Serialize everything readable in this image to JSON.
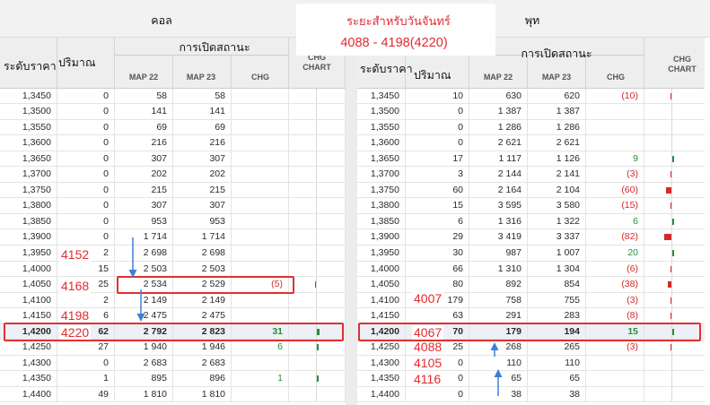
{
  "header": {
    "call_label": "คอล",
    "put_label": "พุท",
    "period_title": "ระยะสำหรับวันจันทร์",
    "range_text": "4088 - 4198(4220)"
  },
  "columns": {
    "strike": "ระดับราคา",
    "volume": "ปริมาณ",
    "open_interest": "การเปิดสถานะ",
    "map22": "MAP 22",
    "map23": "MAP 23",
    "chg": "CHG",
    "chg_chart": "CHG CHART"
  },
  "call_table": {
    "rows": [
      {
        "strike": "1,3450",
        "volume": "0",
        "map22": "58",
        "map23": "58",
        "chg": ""
      },
      {
        "strike": "1,3500",
        "volume": "0",
        "map22": "141",
        "map23": "141",
        "chg": ""
      },
      {
        "strike": "1,3550",
        "volume": "0",
        "map22": "69",
        "map23": "69",
        "chg": ""
      },
      {
        "strike": "1,3600",
        "volume": "0",
        "map22": "216",
        "map23": "216",
        "chg": ""
      },
      {
        "strike": "1,3650",
        "volume": "0",
        "map22": "307",
        "map23": "307",
        "chg": ""
      },
      {
        "strike": "1,3700",
        "volume": "0",
        "map22": "202",
        "map23": "202",
        "chg": ""
      },
      {
        "strike": "1,3750",
        "volume": "0",
        "map22": "215",
        "map23": "215",
        "chg": ""
      },
      {
        "strike": "1,3800",
        "volume": "0",
        "map22": "307",
        "map23": "307",
        "chg": ""
      },
      {
        "strike": "1,3850",
        "volume": "0",
        "map22": "953",
        "map23": "953",
        "chg": ""
      },
      {
        "strike": "1,3900",
        "volume": "0",
        "map22": "1 714",
        "map23": "1 714",
        "chg": ""
      },
      {
        "strike": "1,3950",
        "volume": "2",
        "map22": "2 698",
        "map23": "2 698",
        "chg": ""
      },
      {
        "strike": "1,4000",
        "volume": "15",
        "map22": "2 503",
        "map23": "2 503",
        "chg": ""
      },
      {
        "strike": "1,4050",
        "volume": "25",
        "map22": "2 534",
        "map23": "2 529",
        "chg": "(5)"
      },
      {
        "strike": "1,4100",
        "volume": "2",
        "map22": "2 149",
        "map23": "2 149",
        "chg": ""
      },
      {
        "strike": "1,4150",
        "volume": "6",
        "map22": "2 475",
        "map23": "2 475",
        "chg": ""
      },
      {
        "strike": "1,4200",
        "volume": "62",
        "map22": "2 792",
        "map23": "2 823",
        "chg": "31",
        "highlight": true
      },
      {
        "strike": "1,4250",
        "volume": "27",
        "map22": "1 940",
        "map23": "1 946",
        "chg": "6"
      },
      {
        "strike": "1,4300",
        "volume": "0",
        "map22": "2 683",
        "map23": "2 683",
        "chg": ""
      },
      {
        "strike": "1,4350",
        "volume": "1",
        "map22": "895",
        "map23": "896",
        "chg": "1"
      },
      {
        "strike": "1,4400",
        "volume": "49",
        "map22": "1 810",
        "map23": "1 810",
        "chg": ""
      }
    ]
  },
  "put_table": {
    "rows": [
      {
        "strike": "1,3450",
        "volume": "10",
        "map22": "630",
        "map23": "620",
        "chg": "(10)"
      },
      {
        "strike": "1,3500",
        "volume": "0",
        "map22": "1 387",
        "map23": "1 387",
        "chg": ""
      },
      {
        "strike": "1,3550",
        "volume": "0",
        "map22": "1 286",
        "map23": "1 286",
        "chg": ""
      },
      {
        "strike": "1,3600",
        "volume": "0",
        "map22": "2 621",
        "map23": "2 621",
        "chg": ""
      },
      {
        "strike": "1,3650",
        "volume": "17",
        "map22": "1 117",
        "map23": "1 126",
        "chg": "9"
      },
      {
        "strike": "1,3700",
        "volume": "3",
        "map22": "2 144",
        "map23": "2 141",
        "chg": "(3)"
      },
      {
        "strike": "1,3750",
        "volume": "60",
        "map22": "2 164",
        "map23": "2 104",
        "chg": "(60)"
      },
      {
        "strike": "1,3800",
        "volume": "15",
        "map22": "3 595",
        "map23": "3 580",
        "chg": "(15)"
      },
      {
        "strike": "1,3850",
        "volume": "6",
        "map22": "1 316",
        "map23": "1 322",
        "chg": "6"
      },
      {
        "strike": "1,3900",
        "volume": "29",
        "map22": "3 419",
        "map23": "3 337",
        "chg": "(82)"
      },
      {
        "strike": "1,3950",
        "volume": "30",
        "map22": "987",
        "map23": "1 007",
        "chg": "20"
      },
      {
        "strike": "1,4000",
        "volume": "66",
        "map22": "1 310",
        "map23": "1 304",
        "chg": "(6)"
      },
      {
        "strike": "1,4050",
        "volume": "80",
        "map22": "892",
        "map23": "854",
        "chg": "(38)"
      },
      {
        "strike": "1,4100",
        "volume": "179",
        "map22": "758",
        "map23": "755",
        "chg": "(3)"
      },
      {
        "strike": "1,4150",
        "volume": "63",
        "map22": "291",
        "map23": "283",
        "chg": "(8)"
      },
      {
        "strike": "1,4200",
        "volume": "70",
        "map22": "179",
        "map23": "194",
        "chg": "15",
        "highlight": true
      },
      {
        "strike": "1,4250",
        "volume": "25",
        "map22": "268",
        "map23": "265",
        "chg": "(3)"
      },
      {
        "strike": "1,4300",
        "volume": "0",
        "map22": "110",
        "map23": "110",
        "chg": ""
      },
      {
        "strike": "1,4350",
        "volume": "0",
        "map22": "65",
        "map23": "65",
        "chg": ""
      },
      {
        "strike": "1,4400",
        "volume": "0",
        "map22": "38",
        "map23": "38",
        "chg": ""
      }
    ]
  },
  "annotations": {
    "call": [
      "4152",
      "4168",
      "4198",
      "4220"
    ],
    "put": [
      "4007",
      "4067",
      "4088",
      "4105",
      "4116"
    ]
  },
  "colors": {
    "negative": "#d42a2a",
    "positive": "#23903a",
    "annotation": "#e32a2f",
    "arrow": "#3d7fd6",
    "highlight_border": "#e03030"
  }
}
